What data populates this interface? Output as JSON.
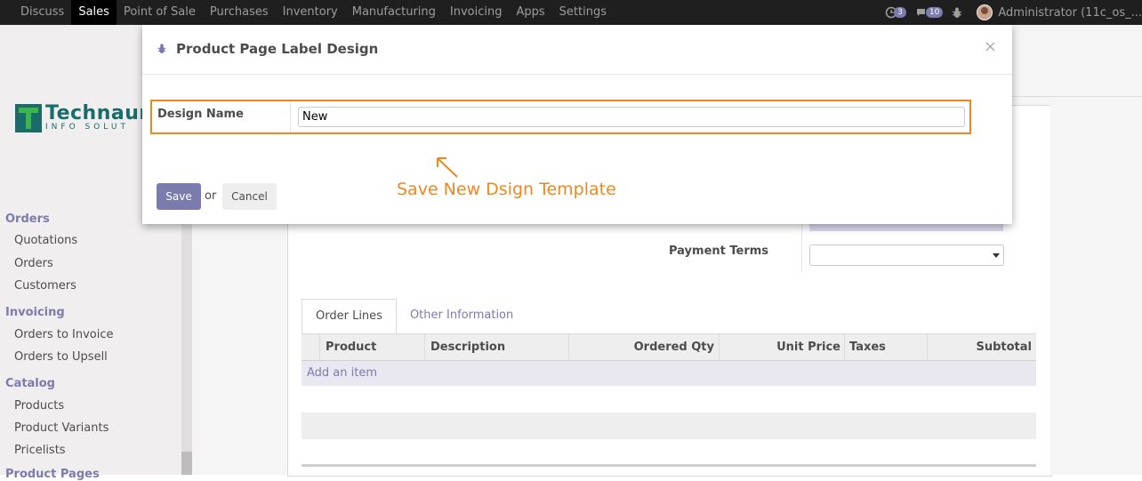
{
  "navbar": {
    "menu": [
      "Discuss",
      "Sales",
      "Point of Sale",
      "Purchases",
      "Inventory",
      "Manufacturing",
      "Invoicing",
      "Apps",
      "Settings"
    ],
    "active_index": 1,
    "activity_count": "3",
    "message_count": "10",
    "user_name": "Administrator (11c_os_..."
  },
  "sidebar": {
    "logo_main": "Technaur",
    "logo_sub": "INFO SOLUT",
    "sections": [
      {
        "title": "Orders",
        "items": [
          "Quotations",
          "Orders",
          "Customers"
        ]
      },
      {
        "title": "Invoicing",
        "items": [
          "Orders to Invoice",
          "Orders to Upsell"
        ]
      },
      {
        "title": "Catalog",
        "items": [
          "Products",
          "Product Variants",
          "Pricelists"
        ]
      },
      {
        "title": "Product Pages"
      }
    ]
  },
  "form": {
    "payment_terms_label": "Payment Terms",
    "tabs": [
      "Order Lines",
      "Other Information"
    ],
    "columns": [
      "Product",
      "Description",
      "Ordered Qty",
      "Unit Price",
      "Taxes",
      "Subtotal"
    ],
    "add_item": "Add an item"
  },
  "modal": {
    "title": "Product Page Label Design",
    "close": "×",
    "field_label": "Design Name",
    "field_value": "New",
    "annotation": "Save New Dsign Template",
    "save": "Save",
    "or": "or",
    "cancel": "Cancel"
  },
  "colors": {
    "accent": "#7c7bad",
    "highlight": "#f0871e",
    "navbar": "#1f1f1f"
  }
}
